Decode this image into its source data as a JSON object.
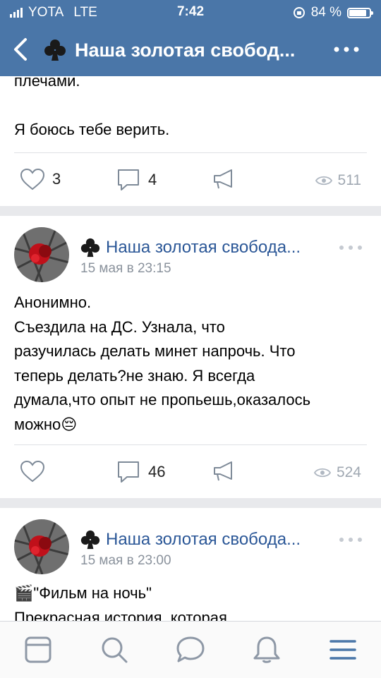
{
  "status_bar": {
    "carrier": "YOTA",
    "network": "LTE",
    "time": "7:42",
    "battery": "84 %",
    "battery_level": 0.84
  },
  "header": {
    "title": "Наша золотая свобод...",
    "back_icon": "chevron-left-icon",
    "group_icon": "club-suit-icon",
    "menu_icon": "more-horizontal-icon"
  },
  "posts": [
    {
      "text_lines": [
        "плечами.",
        "",
        "Я боюсь тебе верить."
      ],
      "likes": "3",
      "comments": "4",
      "views": "511"
    },
    {
      "author": "Наша золотая свобода...",
      "date": "15 мая в 23:15",
      "text_lines": [
        "Анонимно.",
        "Съездила на ДС.  Узнала, что",
        "разучилась делать минет напрочь. Что",
        "теперь делать?не знаю. Я всегда",
        "думала,что опыт не пропьешь,оказалось",
        "можно"
      ],
      "emoji": "😔",
      "likes": "",
      "comments": "46",
      "views": "524"
    },
    {
      "author": "Наша золотая свобода...",
      "date": "15 мая в 23:00",
      "text_lines": [
        "\"Фильм на ночь\"",
        "Прекрасная история, которая"
      ],
      "emoji": "🎬"
    }
  ],
  "tab_bar": {
    "items": [
      "news-icon",
      "search-icon",
      "messages-icon",
      "notifications-icon",
      "menu-icon"
    ],
    "active_color": "#4a76a8"
  }
}
